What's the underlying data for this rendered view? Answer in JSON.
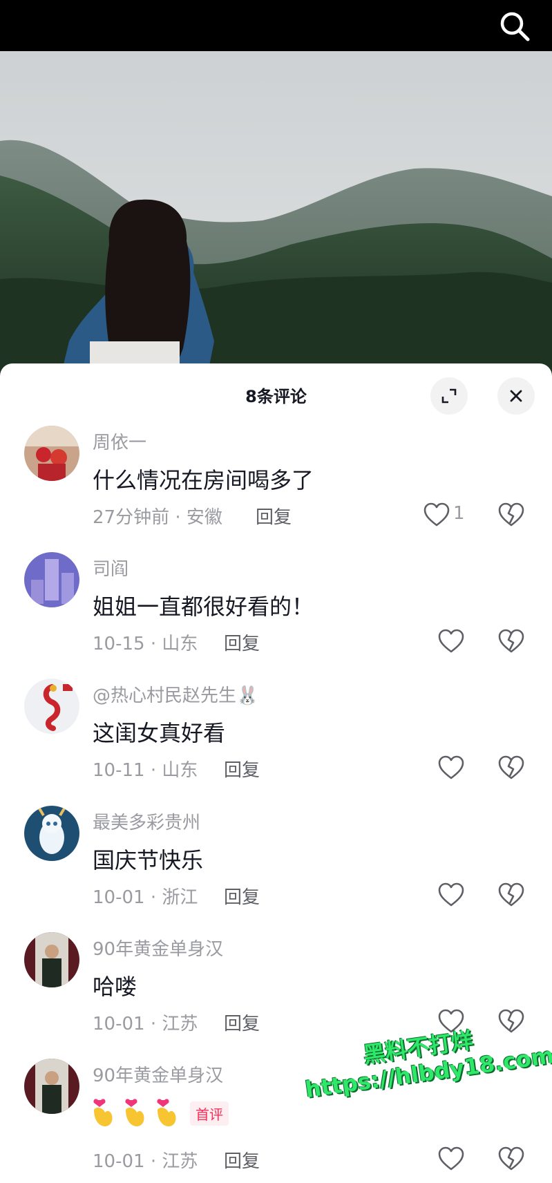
{
  "comments_panel": {
    "title": "8条评论"
  },
  "comments": [
    {
      "username": "周依一",
      "text": "什么情况在房间喝多了",
      "meta": "27分钟前 · 安徽",
      "reply": "回复",
      "likes": "1"
    },
    {
      "username": "司阎",
      "text": "姐姐一直都很好看的！",
      "meta": "10-15 · 山东",
      "reply": "回复",
      "likes": ""
    },
    {
      "username": "@热心村民赵先生🐰",
      "text": "这闺女真好看",
      "meta": "10-11 · 山东",
      "reply": "回复",
      "likes": ""
    },
    {
      "username": "最美多彩贵州",
      "text": "国庆节快乐",
      "meta": "10-01 · 浙江",
      "reply": "回复",
      "likes": ""
    },
    {
      "username": "90年黄金单身汉",
      "text": "哈喽",
      "meta": "10-01 · 江苏",
      "reply": "回复",
      "likes": ""
    },
    {
      "username": "90年黄金单身汉",
      "text": "",
      "badge": "首评",
      "meta": "10-01 · 江苏",
      "reply": "回复",
      "likes": ""
    }
  ],
  "watermark": {
    "line1": "黑料不打烊",
    "line2": "https://hlbdy18.com"
  },
  "colors": {
    "accent": "#fe2c55",
    "watermark": "#2fe86a"
  },
  "icons": [
    "search-icon",
    "expand-icon",
    "close-icon",
    "heart-icon",
    "broken-heart-icon",
    "heart-hands-emoji"
  ]
}
